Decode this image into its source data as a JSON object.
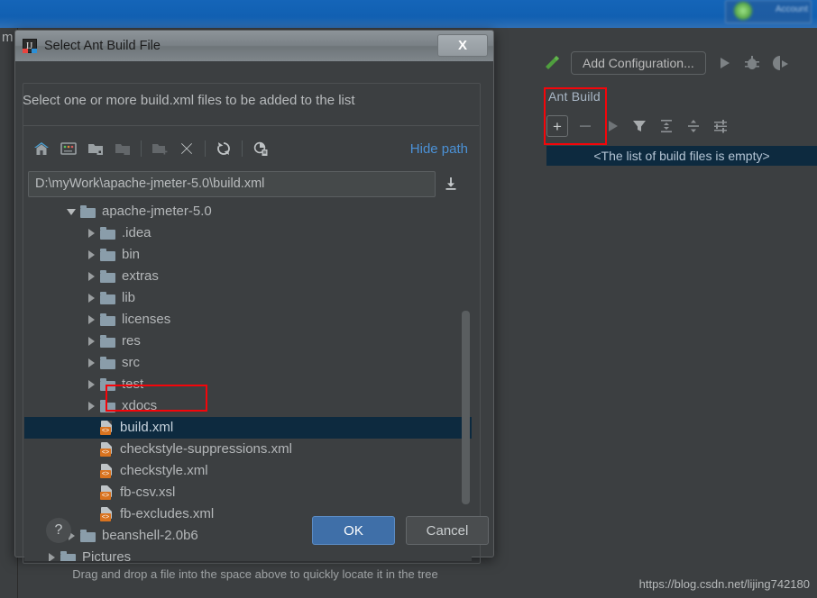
{
  "ide": {
    "ghost_letter": "m",
    "blurred_widget_label": "Account",
    "run_toolbar": {
      "build_icon": "hammer-icon",
      "add_configuration_label": "Add Configuration...",
      "run_icon": "run-play-icon",
      "debug_icon": "debug-bug-icon",
      "coverage_icon": "run-coverage-icon"
    },
    "ant_panel": {
      "title": "Ant Build",
      "toolbar": [
        {
          "name": "add-build-file-button",
          "glyph": "+"
        },
        {
          "name": "remove-build-file-button",
          "glyph": "−"
        },
        {
          "name": "run-build-button",
          "glyph": "run-play-icon"
        },
        {
          "name": "filter-targets-button",
          "glyph": "filter-icon"
        },
        {
          "name": "expand-all-button",
          "glyph": "expand-all-icon"
        },
        {
          "name": "collapse-all-button",
          "glyph": "collapse-all-icon"
        },
        {
          "name": "ant-properties-button",
          "glyph": "settings-sliders-icon"
        }
      ],
      "empty_message": "<The list of build files is empty>"
    },
    "watermark": "https://blog.csdn.net/lijing742180"
  },
  "dialog": {
    "title": "Select Ant Build File",
    "title_icon": "intellij-idea-icon",
    "close_label": "X",
    "subtitle": "Select one or more build.xml files to be added to the list",
    "toolbar": [
      {
        "name": "home-icon",
        "enabled": true
      },
      {
        "name": "desktop-icon",
        "enabled": true
      },
      {
        "name": "project-folder-icon",
        "enabled": true
      },
      {
        "name": "module-folder-icon",
        "enabled": false
      },
      {
        "name": "new-folder-icon",
        "enabled": false
      },
      {
        "name": "delete-icon",
        "enabled": true
      },
      {
        "name": "refresh-icon",
        "enabled": true
      },
      {
        "name": "show-hidden-files-icon",
        "enabled": true
      }
    ],
    "hide_path_label": "Hide path",
    "path_value": "D:\\myWork\\apache-jmeter-5.0\\build.xml",
    "path_placeholder": "",
    "path_dropdown_icon": "insert-path-icon",
    "tree": [
      {
        "label": "apache-jmeter-5.0",
        "indent": 2,
        "type": "folder",
        "state": "expanded",
        "selected": false
      },
      {
        "label": ".idea",
        "indent": 3,
        "type": "folder",
        "state": "collapsed",
        "selected": false
      },
      {
        "label": "bin",
        "indent": 3,
        "type": "folder",
        "state": "collapsed",
        "selected": false
      },
      {
        "label": "extras",
        "indent": 3,
        "type": "folder",
        "state": "collapsed",
        "selected": false
      },
      {
        "label": "lib",
        "indent": 3,
        "type": "folder",
        "state": "collapsed",
        "selected": false
      },
      {
        "label": "licenses",
        "indent": 3,
        "type": "folder",
        "state": "collapsed",
        "selected": false
      },
      {
        "label": "res",
        "indent": 3,
        "type": "folder",
        "state": "collapsed",
        "selected": false
      },
      {
        "label": "src",
        "indent": 3,
        "type": "folder",
        "state": "collapsed",
        "selected": false
      },
      {
        "label": "test",
        "indent": 3,
        "type": "folder",
        "state": "collapsed",
        "selected": false
      },
      {
        "label": "xdocs",
        "indent": 3,
        "type": "folder",
        "state": "collapsed",
        "selected": false
      },
      {
        "label": "build.xml",
        "indent": 3,
        "type": "xml",
        "state": "leaf",
        "selected": true
      },
      {
        "label": "checkstyle-suppressions.xml",
        "indent": 3,
        "type": "xml",
        "state": "leaf",
        "selected": false
      },
      {
        "label": "checkstyle.xml",
        "indent": 3,
        "type": "xml",
        "state": "leaf",
        "selected": false
      },
      {
        "label": "fb-csv.xsl",
        "indent": 3,
        "type": "xml",
        "state": "leaf",
        "selected": false
      },
      {
        "label": "fb-excludes.xml",
        "indent": 3,
        "type": "xml",
        "state": "leaf",
        "selected": false
      },
      {
        "label": "beanshell-2.0b6",
        "indent": 2,
        "type": "folder",
        "state": "collapsed",
        "selected": false
      },
      {
        "label": "Pictures",
        "indent": 1,
        "type": "folder",
        "state": "collapsed",
        "selected": false
      }
    ],
    "hint": "Drag and drop a file into the space above to quickly locate it in the tree",
    "help_label": "?",
    "ok_label": "OK",
    "cancel_label": "Cancel"
  },
  "annotations": {
    "color": "#f5050a",
    "boxes": [
      "build.xml tree node",
      "Ant Build add button"
    ]
  }
}
